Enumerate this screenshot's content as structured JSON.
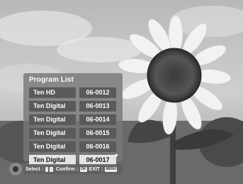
{
  "program_list": {
    "title": "Program List",
    "items": [
      {
        "name": "Ten HD",
        "number": "06-0012",
        "selected": false
      },
      {
        "name": "Ten Digital",
        "number": "06-0013",
        "selected": false
      },
      {
        "name": "Ten Digital",
        "number": "06-0014",
        "selected": false
      },
      {
        "name": "Ten Digital",
        "number": "06-0015",
        "selected": false
      },
      {
        "name": "Ten Digital",
        "number": "06-0016",
        "selected": false
      },
      {
        "name": "Ten Digital",
        "number": "06-0017",
        "selected": true
      }
    ],
    "scroll_icon": "arrow-down"
  },
  "help_bar": {
    "select_label": "Select :",
    "select_keys": [
      "↑",
      "↓"
    ],
    "confirm_label": "Confirm :",
    "confirm_key": "OK",
    "exit_label": "EXIT :",
    "exit_key": "MENU"
  },
  "background": {
    "image": "sunflower-photo"
  }
}
